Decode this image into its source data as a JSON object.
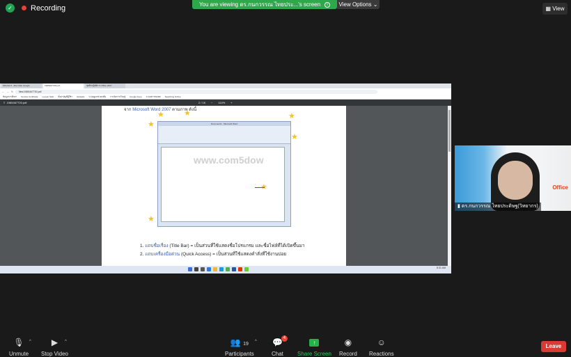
{
  "top": {
    "recording_label": "Recording",
    "banner_text": "You are viewing ดร.กนกวรรณ ไทยประ...'s screen",
    "view_options_label": "View Options",
    "view_button_label": "View"
  },
  "shared_screen": {
    "tabs": [
      "สอบ คอ ท - Man Man Google",
      "1985467700.pdf",
      "ชุดฝึกปฏิบัติการ Office 2007"
    ],
    "url": "files/1985467700.pdf",
    "bookmarks": [
      "ข้อมูลการศึกษา",
      "Service Certificate",
      "Lesson Start",
      "ตั้งค่าบัญชีผู้ใช้ฯ",
      "hotdeals",
      "ระบบดูแลช่วยเหลือ",
      "การจัดการเรียนรู้",
      "Google Keep",
      "ระบบสารสนเทศ",
      "Searching Online"
    ],
    "pdf_filename": "1985467700.pdf",
    "pdf_page": "2 / 16",
    "pdf_zoom": "114%",
    "page_top_text_prefix": "จาก",
    "page_top_text_link": "Microsoft Word 2007",
    "page_top_text_suffix": "ตามภาพ ดังนี้",
    "watermark": "www.com5dow",
    "word_title": "Document1 - Microsoft Word",
    "list_items": [
      {
        "num": "1.",
        "label": "แถบชื่อเรื่อง",
        "rest": "(Title Bar) = เป็นส่วนที่ใช้แสดงชื่อโปรแกรม และชื่อไฟล์ที่ได้เปิดขึ้นมา"
      },
      {
        "num": "2.",
        "label": "แถบเครื่องมือด่วน",
        "rest": "(Quick Access) = เป็นส่วนที่ใช้แสดงคำสั่งที่ใช้งานบ่อย"
      }
    ],
    "clock": "8:31 AM"
  },
  "video": {
    "participant_name": "ดร.กนกวรรณ ไทยประดิษฐ(วิทยากร)",
    "office_label": "Office"
  },
  "controls": {
    "unmute": "Unmute",
    "stop_video": "Stop Video",
    "participants": "Participants",
    "participants_count": "19",
    "chat": "Chat",
    "chat_badge": "4",
    "share_screen": "Share Screen",
    "record": "Record",
    "reactions": "Reactions",
    "leave": "Leave"
  }
}
